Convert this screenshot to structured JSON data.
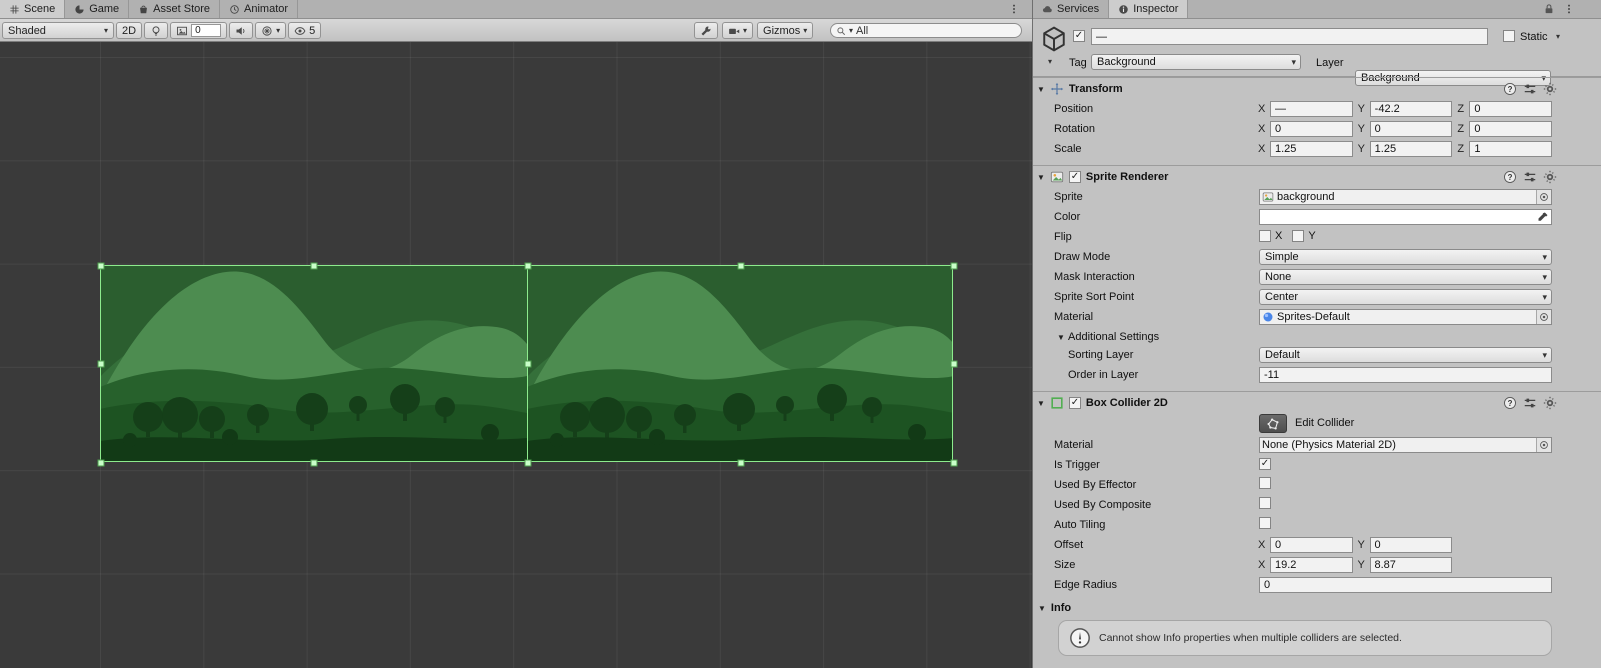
{
  "scene": {
    "tabs": [
      {
        "label": "Scene"
      },
      {
        "label": "Game"
      },
      {
        "label": "Asset Store"
      },
      {
        "label": "Animator"
      }
    ],
    "toolbar": {
      "shading_mode": "Shaded",
      "mode_2d": "2D",
      "exposure": "0",
      "hidden_count": "5",
      "gizmos_label": "Gizmos",
      "search_value": "All"
    }
  },
  "inspector": {
    "tabs": [
      {
        "label": "Services"
      },
      {
        "label": "Inspector"
      }
    ],
    "header": {
      "name": "—",
      "static_label": "Static",
      "tag_label": "Tag",
      "tag_value": "Background",
      "layer_label": "Layer",
      "layer_value": "Background"
    },
    "axis": {
      "x": "X",
      "y": "Y",
      "z": "Z"
    },
    "transform": {
      "title": "Transform",
      "position": {
        "label": "Position",
        "x": "—",
        "y": "-42.2",
        "z": "0"
      },
      "rotation": {
        "label": "Rotation",
        "x": "0",
        "y": "0",
        "z": "0"
      },
      "scale": {
        "label": "Scale",
        "x": "1.25",
        "y": "1.25",
        "z": "1"
      }
    },
    "sprite_renderer": {
      "title": "Sprite Renderer",
      "sprite_label": "Sprite",
      "sprite_value": "background",
      "color_label": "Color",
      "flip_label": "Flip",
      "flip_x": "X",
      "flip_y": "Y",
      "draw_mode_label": "Draw Mode",
      "draw_mode_value": "Simple",
      "mask_interaction_label": "Mask Interaction",
      "mask_interaction_value": "None",
      "sprite_sort_point_label": "Sprite Sort Point",
      "sprite_sort_point_value": "Center",
      "material_label": "Material",
      "material_value": "Sprites-Default",
      "additional_settings_label": "Additional Settings",
      "sorting_layer_label": "Sorting Layer",
      "sorting_layer_value": "Default",
      "order_in_layer_label": "Order in Layer",
      "order_in_layer_value": "-11"
    },
    "box_collider": {
      "title": "Box Collider 2D",
      "edit_collider_label": "Edit Collider",
      "material_label": "Material",
      "material_value": "None (Physics Material 2D)",
      "is_trigger_label": "Is Trigger",
      "used_by_effector_label": "Used By Effector",
      "used_by_composite_label": "Used By Composite",
      "auto_tiling_label": "Auto Tiling",
      "offset_label": "Offset",
      "offset_x": "0",
      "offset_y": "0",
      "size_label": "Size",
      "size_x": "19.2",
      "size_y": "8.87",
      "edge_radius_label": "Edge Radius",
      "edge_radius_value": "0"
    },
    "info": {
      "title": "Info",
      "message": "Cannot show Info properties when multiple colliders are selected."
    }
  },
  "colors": {
    "selection_green": "#8deb8d",
    "scene_background": "#3a3a3a",
    "panel_background": "#c2c2c2",
    "hill_front_green": "#4d8c50",
    "tree_dark_green": "#153f19"
  },
  "icons": [
    "scene-grid-icon",
    "game-icon",
    "asset-store-icon",
    "animator-icon",
    "services-cloud-icon",
    "inspector-icon",
    "lock-icon",
    "menu-dots-icon",
    "cube-icon",
    "help-icon",
    "presets-icon",
    "gear-icon",
    "wrench-icon",
    "camera-icon",
    "search-icon",
    "lightbulb-icon",
    "image-icon",
    "audio-icon",
    "effects-icon",
    "eye-icon",
    "transform-icon",
    "sprite-renderer-icon",
    "box-collider-icon",
    "object-picker-icon",
    "eyedropper-icon",
    "edit-collider-icon",
    "warning-icon"
  ]
}
